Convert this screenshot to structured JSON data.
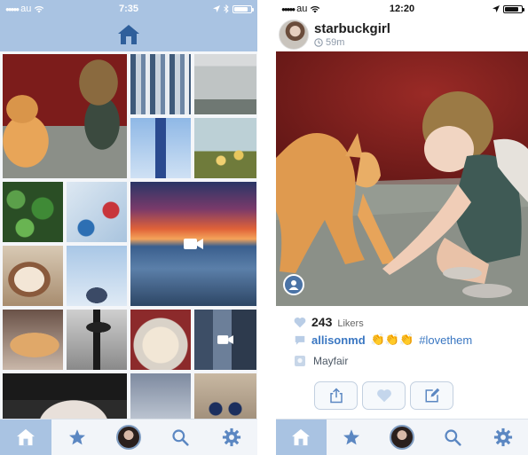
{
  "left_phone": {
    "status": {
      "carrier": "au",
      "time": "7:35"
    },
    "header_icon": "home-icon",
    "tabs": [
      {
        "name": "home",
        "icon": "home-icon",
        "active": true
      },
      {
        "name": "favorites",
        "icon": "star-icon",
        "active": false
      },
      {
        "name": "profile",
        "icon": "avatar",
        "active": false
      },
      {
        "name": "search",
        "icon": "search-icon",
        "active": false
      },
      {
        "name": "settings",
        "icon": "gear-icon",
        "active": false
      }
    ]
  },
  "right_phone": {
    "status": {
      "carrier": "au",
      "time": "12:20"
    },
    "post": {
      "username": "starbuckgirl",
      "time_ago": "59m",
      "likes_count": "243",
      "likes_label": "Likers",
      "comment_user": "allisonmd",
      "comment_emoji": "👏👏👏",
      "comment_tag": "#lovethem",
      "location": "Mayfair"
    },
    "tabs": [
      {
        "name": "home",
        "icon": "home-icon",
        "active": true
      },
      {
        "name": "favorites",
        "icon": "star-icon",
        "active": false
      },
      {
        "name": "profile",
        "icon": "avatar",
        "active": false
      },
      {
        "name": "search",
        "icon": "search-icon",
        "active": false
      },
      {
        "name": "settings",
        "icon": "gear-icon",
        "active": false
      }
    ]
  },
  "colors": {
    "accent": "#a9c3e2",
    "link_blue": "#3a77c2",
    "icon_blue": "#5b87c2"
  }
}
